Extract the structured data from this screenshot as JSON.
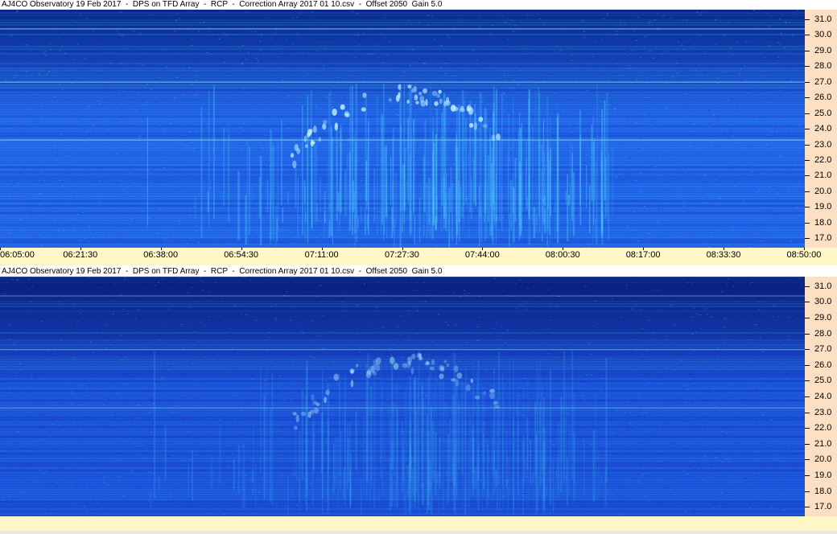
{
  "chart_data": [
    {
      "type": "heatmap",
      "title": "AJ4CO Observatory 19 Feb 2017  -  DPS on TFD Array  -  RCP  -  Correction Array 2017 01 10.csv  -  Offset 2050  Gain 5.0",
      "x_tick_labels": [
        "06:05:00",
        "06:21:30",
        "06:38:00",
        "06:54:30",
        "07:11:00",
        "07:27:30",
        "07:44:00",
        "08:00:30",
        "08:17:00",
        "08:33:30",
        "08:50:00"
      ],
      "y_tick_labels": [
        "31.0",
        "30.0",
        "29.0",
        "28.0",
        "27.0",
        "26.0",
        "25.0",
        "24.0",
        "23.0",
        "22.0",
        "21.0",
        "20.0",
        "19.0",
        "18.0",
        "17.0"
      ],
      "ylim": [
        16.4,
        31.6
      ],
      "colormap": [
        "#0a2a8c",
        "#1f5fe6",
        "#4fd0ff"
      ],
      "gain": 1.0
    },
    {
      "type": "heatmap",
      "title": "AJ4CO Observatory 19 Feb 2017  -  DPS on TFD Array  -  RCP  -  Correction Array 2017 01 10.csv  -  Offset 2050  Gain 5.0",
      "x_tick_labels": [],
      "y_tick_labels": [
        "31.0",
        "30.0",
        "29.0",
        "28.0",
        "27.0",
        "26.0",
        "25.0",
        "24.0",
        "23.0",
        "22.0",
        "21.0",
        "20.0",
        "19.0",
        "18.0",
        "17.0"
      ],
      "ylim": [
        16.4,
        31.6
      ],
      "colormap": [
        "#0a1e78",
        "#1a4fd8",
        "#3fb8f8"
      ],
      "gain": 0.6
    }
  ],
  "colors": {
    "axis_bg": "#fde0c4",
    "time_bg": "#fff7c8"
  }
}
